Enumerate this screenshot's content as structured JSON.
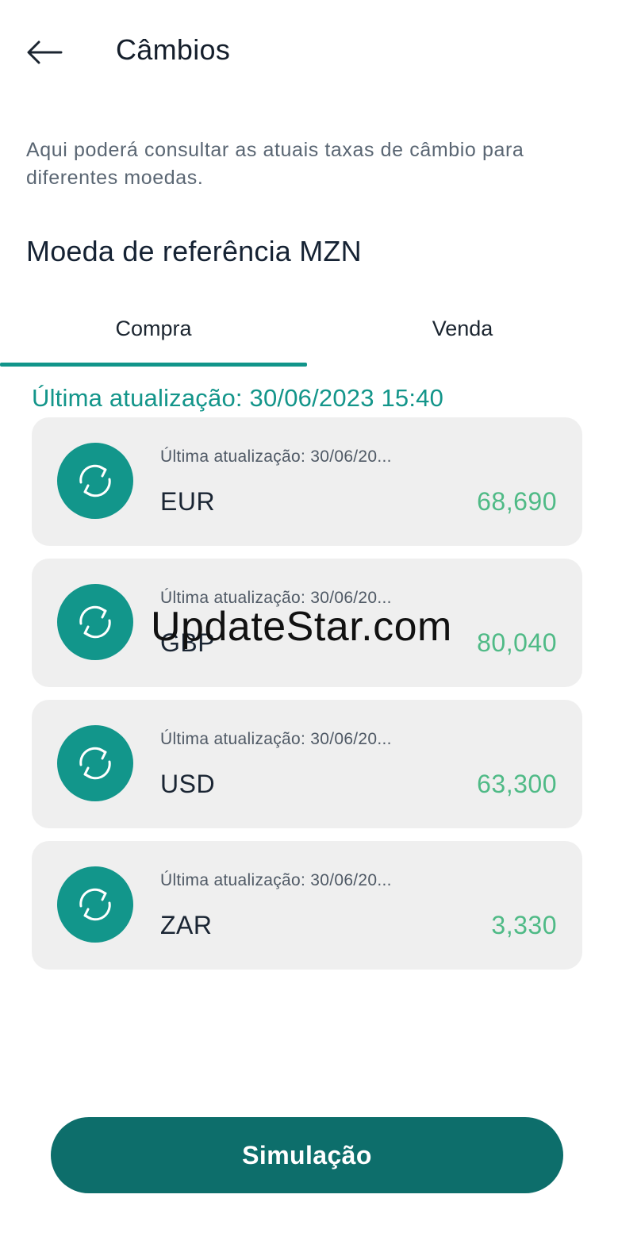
{
  "header": {
    "title": "Câmbios",
    "back_icon": "arrow-left-icon"
  },
  "description": "Aqui poderá consultar as atuais taxas de câmbio para diferentes moedas.",
  "reference_title": "Moeda de referência MZN",
  "tabs": [
    {
      "label": "Compra",
      "active": true
    },
    {
      "label": "Venda",
      "active": false
    }
  ],
  "last_update": "Última atualização: 30/06/2023 15:40",
  "rates": [
    {
      "updated": "Última atualização: 30/06/20...",
      "code": "EUR",
      "rate": "68,690",
      "icon": "refresh-icon"
    },
    {
      "updated": "Última atualização: 30/06/20...",
      "code": "GBP",
      "rate": "80,040",
      "icon": "refresh-icon"
    },
    {
      "updated": "Última atualização: 30/06/20...",
      "code": "USD",
      "rate": "63,300",
      "icon": "refresh-icon"
    },
    {
      "updated": "Última atualização: 30/06/20...",
      "code": "ZAR",
      "rate": "3,330",
      "icon": "refresh-icon"
    }
  ],
  "watermark": "UpdateStar.com",
  "simulate_button": "Simulação",
  "colors": {
    "accent": "#12968b",
    "button": "#0d6e6b",
    "rate_text": "#4fba86",
    "card_bg": "#efefef"
  }
}
